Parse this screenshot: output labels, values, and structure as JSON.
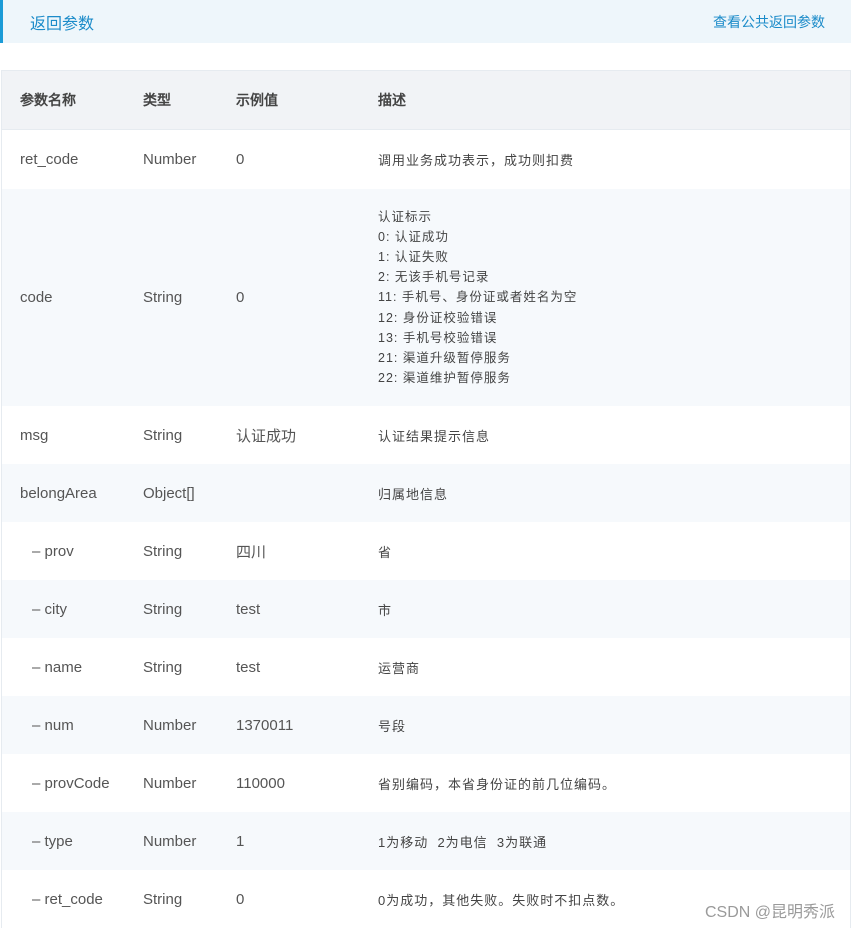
{
  "header": {
    "title": "返回参数",
    "link": "查看公共返回参数"
  },
  "table": {
    "columns": [
      "参数名称",
      "类型",
      "示例值",
      "描述"
    ],
    "rows": [
      {
        "name": "ret_code",
        "type": "Number",
        "example": "0",
        "desc": "调用业务成功表示，成功则扣费"
      },
      {
        "name": "code",
        "type": "String",
        "example": "0",
        "desc_lines": [
          "认证标示",
          "0: 认证成功",
          "1: 认证失败",
          "2: 无该手机号记录",
          "11: 手机号、身份证或者姓名为空",
          "12: 身份证校验错误",
          "13: 手机号校验错误",
          "21: 渠道升级暂停服务",
          "22: 渠道维护暂停服务"
        ]
      },
      {
        "name": "msg",
        "type": "String",
        "example": "认证成功",
        "desc": "认证结果提示信息"
      },
      {
        "name": "belongArea",
        "type": "Object[]",
        "example": "",
        "desc": "归属地信息"
      },
      {
        "name": "– prov",
        "type": "String",
        "example": "四川",
        "desc": "省"
      },
      {
        "name": "– city",
        "type": "String",
        "example": "test",
        "desc": "市"
      },
      {
        "name": "– name",
        "type": "String",
        "example": "test",
        "desc": "运营商"
      },
      {
        "name": "– num",
        "type": "Number",
        "example": "1370011",
        "desc": "号段"
      },
      {
        "name": "– provCode",
        "type": "Number",
        "example": "110000",
        "desc": "省别编码，本省身份证的前几位编码。"
      },
      {
        "name": "– type",
        "type": "Number",
        "example": "1",
        "desc": "1为移动  2为电信  3为联通"
      },
      {
        "name": "– ret_code",
        "type": "String",
        "example": "0",
        "desc": "0为成功，其他失败。失败时不扣点数。"
      }
    ]
  },
  "watermark": "CSDN @昆明秀派",
  "colors": {
    "accent": "#1b9bd7",
    "header_bg": "#eef6fb",
    "table_head_bg": "#f1f3f6",
    "row_alt_bg": "#f6f9fc"
  }
}
